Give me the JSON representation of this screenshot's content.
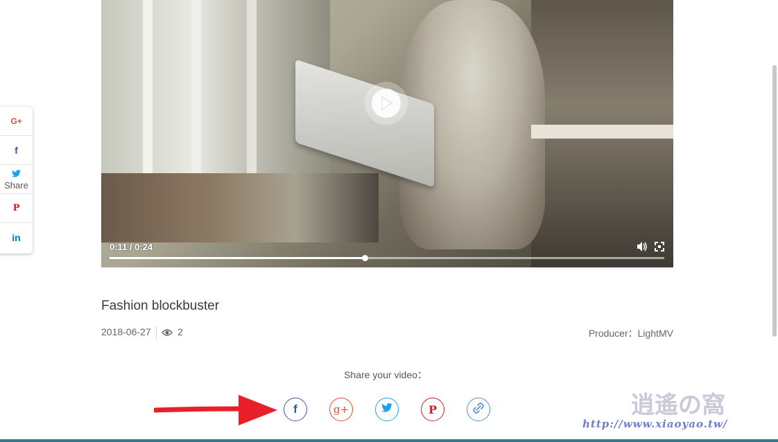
{
  "player": {
    "time_display": "0:11 / 0:24",
    "progress": 0.46,
    "icons": {
      "play": "play-icon",
      "volume": "volume-icon",
      "fullscreen": "fullscreen-icon"
    }
  },
  "side_share": {
    "items": [
      {
        "icon": "google-plus-icon",
        "glyph": "G+",
        "color": "#dd4b39"
      },
      {
        "icon": "facebook-icon",
        "glyph": "f",
        "color": "#3b5998"
      },
      {
        "icon": "twitter-icon",
        "glyph": "",
        "color": "#1da1f2",
        "label": "Share"
      },
      {
        "icon": "pinterest-icon",
        "glyph": "P",
        "color": "#cb2027"
      },
      {
        "icon": "linkedin-icon",
        "glyph": "in",
        "color": "#0077b5"
      }
    ]
  },
  "video": {
    "title": "Fashion blockbuster",
    "date": "2018-06-27",
    "views": "2",
    "producer": "Producer：LightMV"
  },
  "share": {
    "caption": "Share your video：",
    "buttons": [
      {
        "icon": "facebook-icon",
        "glyph": "f",
        "color": "#3b5998"
      },
      {
        "icon": "google-plus-icon",
        "glyph": "g+",
        "color": "#dd4b39"
      },
      {
        "icon": "twitter-icon",
        "glyph": "",
        "color": "#1da1f2"
      },
      {
        "icon": "pinterest-icon",
        "glyph": "P",
        "color": "#cb2027"
      },
      {
        "icon": "link-icon",
        "glyph": "",
        "color": "#4a90d9"
      }
    ]
  },
  "watermark": {
    "url": "http://www.xiaoyao.tw/",
    "logo": "逍遙の窩"
  }
}
